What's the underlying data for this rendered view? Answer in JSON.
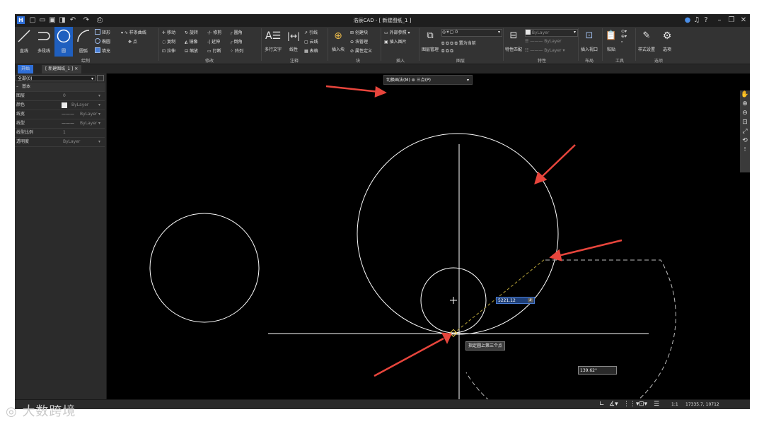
{
  "window": {
    "title": "浩辰CAD - [ 新建图纸_1 ]",
    "logo": "H",
    "quick_access": [
      "new-icon",
      "open-icon",
      "save-icon",
      "save-as-icon",
      "undo-icon",
      "redo-icon",
      "print-icon"
    ],
    "controls": [
      "user-icon",
      "help-icon",
      "question-icon",
      "minimize-icon",
      "restore-icon",
      "close-icon"
    ]
  },
  "ribbon": {
    "draw": {
      "title": "绘制",
      "line": "直线",
      "polyline": "多段线",
      "circle": "圆",
      "arc": "圆弧",
      "rect": "矩形",
      "ellipse": "椭圆",
      "hatch": "填充",
      "spline": "样条曲线",
      "point": "点"
    },
    "modify": {
      "title": "修改",
      "items": [
        "移动",
        "旋转",
        "修剪",
        "圆角",
        "复制",
        "镜像",
        "延伸",
        "倒角",
        "拉伸",
        "缩放",
        "打断",
        "阵列"
      ]
    },
    "annotate": {
      "title": "注释",
      "mtext": "多行文字",
      "linear": "线性",
      "leader": "引线",
      "revcloud": "云线",
      "table": "表格"
    },
    "block": {
      "title": "块",
      "insert": "插入块",
      "create": "创建块",
      "manage": "块管理",
      "attdef": "属性定义"
    },
    "insert": {
      "title": "插入",
      "xref": "外部参照",
      "image": "插入图片"
    },
    "layers": {
      "title": "图层",
      "manager": "图层管理",
      "current_layer": "0",
      "make_current": "置为当前"
    },
    "properties": {
      "title": "特性",
      "match": "特性匹配",
      "bylayer1": "ByLayer",
      "bylayer2": "ByLayer",
      "bylayer3": "ByLayer"
    },
    "layout": {
      "title": "布局",
      "viewport": "插入视口"
    },
    "tools": {
      "title": "工具",
      "paste": "粘贴"
    },
    "options": {
      "title": "选项",
      "style": "样式设置",
      "options": "选项"
    }
  },
  "tabs": [
    {
      "label": "开始"
    },
    {
      "label": "[ 新建图纸_1 ]"
    }
  ],
  "props_panel": {
    "selection": "全部(0)",
    "section": "基本",
    "rows": [
      {
        "key": "图层",
        "value": "0"
      },
      {
        "key": "颜色",
        "value": "ByLayer"
      },
      {
        "key": "线宽",
        "value": "ByLayer"
      },
      {
        "key": "线型",
        "value": "ByLayer"
      },
      {
        "key": "线型比例",
        "value": "1"
      },
      {
        "key": "透明度",
        "value": "ByLayer"
      }
    ]
  },
  "canvas": {
    "cmd_label": "切换画法(M)",
    "cmd_value": "三点(P)",
    "length_input": "5221.12",
    "prompt": "指定圆上第三个点",
    "angle_input": "139.62°",
    "annotation_color": "#e8453c"
  },
  "status": {
    "scale": "1:1",
    "coords": "17335.7, 10712"
  },
  "watermark": "大数跨境"
}
